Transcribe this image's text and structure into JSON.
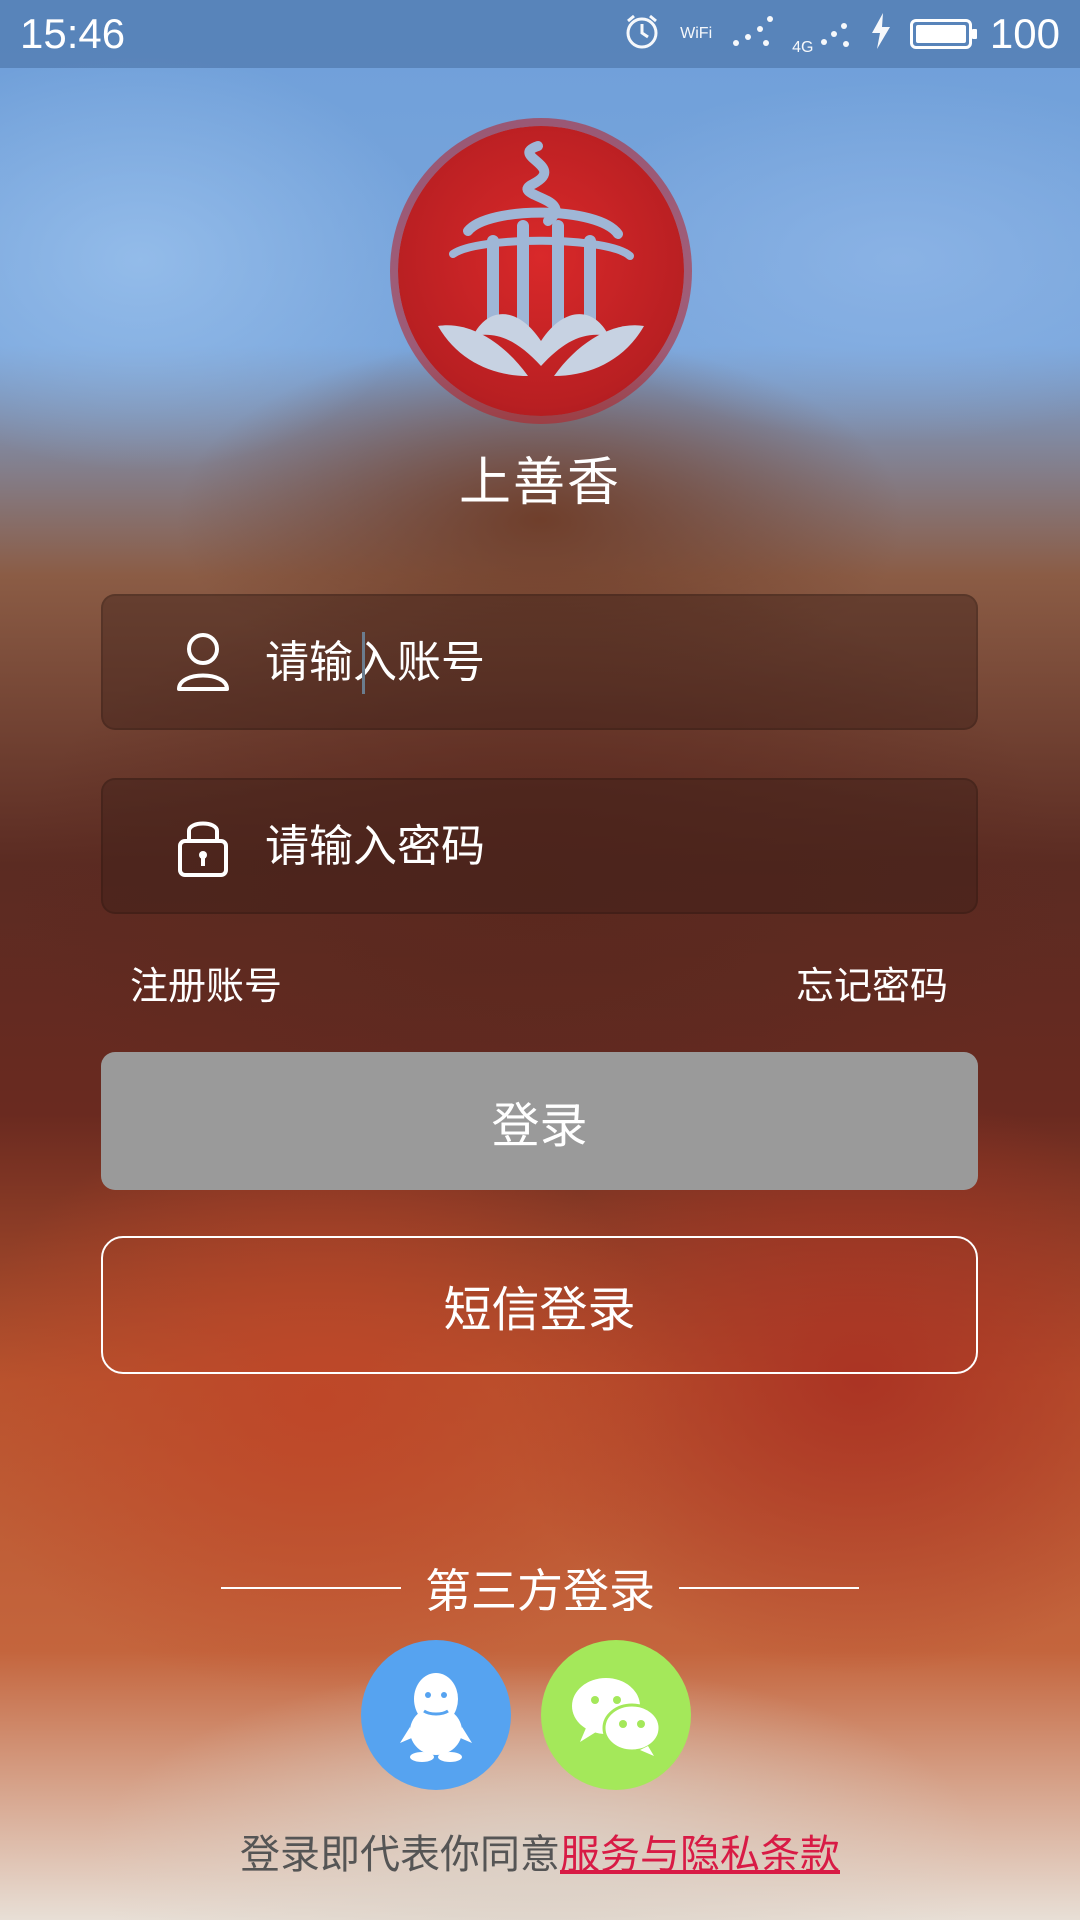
{
  "status_bar": {
    "time": "15:46",
    "icons": [
      "alarm-icon",
      "wifi-icon",
      "signal-icon",
      "4g-signal-icon",
      "charging-icon",
      "battery-icon"
    ],
    "wifi_label": "WiFi",
    "network_label": "4G",
    "battery_percent": "100"
  },
  "app": {
    "name": "上善香",
    "logo_icon": "temple-seal-logo"
  },
  "login_form": {
    "account_placeholder": "请输入账号",
    "password_placeholder": "请输入密码",
    "register_link": "注册账号",
    "forgot_password_link": "忘记密码",
    "login_button": "登录",
    "sms_login_button": "短信登录"
  },
  "third_party": {
    "title": "第三方登录",
    "providers": [
      {
        "name": "QQ",
        "icon": "qq-penguin-icon",
        "color": "#56a3f0"
      },
      {
        "name": "WeChat",
        "icon": "wechat-icon",
        "color": "#a4e85a"
      }
    ]
  },
  "terms": {
    "prefix": "登录即代表你同意",
    "link": "服务与隐私条款"
  },
  "colors": {
    "login_button_bg": "#9a9a9a",
    "terms_link": "#d81b45",
    "logo_red": "#c4232a"
  }
}
